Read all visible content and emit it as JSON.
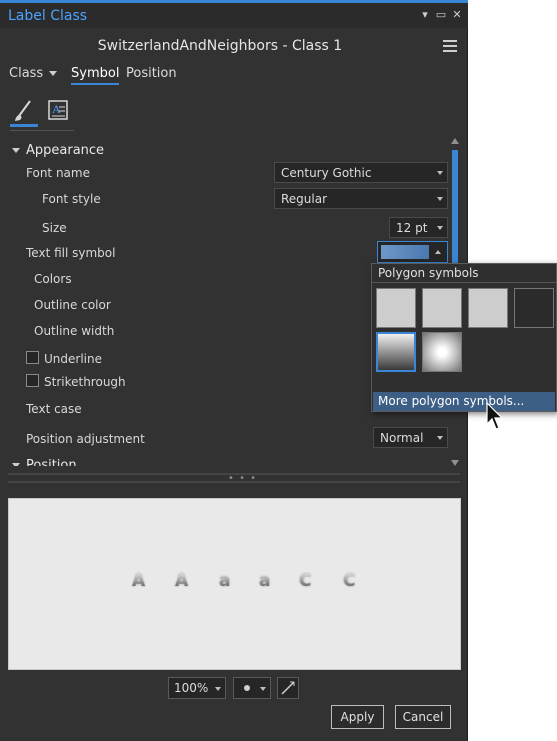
{
  "window": {
    "title": "Label Class",
    "layer_name": "SwitzerlandAndNeighbors - Class 1"
  },
  "tabs": [
    {
      "label": "Class"
    },
    {
      "label": "Symbol"
    },
    {
      "label": "Position"
    }
  ],
  "appearance": {
    "section_label": "Appearance",
    "font_name_label": "Font name",
    "font_name_value": "Century Gothic",
    "font_style_label": "Font style",
    "font_style_value": "Regular",
    "size_label": "Size",
    "size_value": "12 pt",
    "text_fill_label": "Text fill symbol",
    "colors_label": "Colors",
    "outline_color_label": "Outline color",
    "outline_width_label": "Outline width",
    "underline_label": "Underline",
    "strikethrough_label": "Strikethrough",
    "text_case_label": "Text case",
    "position_adjustment_label": "Position adjustment",
    "position_adjustment_value": "Normal",
    "next_section_label": "Position"
  },
  "popup": {
    "title": "Polygon symbols",
    "more_label": "More polygon symbols..."
  },
  "preview": {
    "glyphs": [
      "A",
      "A",
      "a",
      "a",
      "C",
      "C"
    ]
  },
  "bottom": {
    "zoom_value": "100%",
    "apply_label": "Apply",
    "cancel_label": "Cancel"
  },
  "colors": {
    "accent": "#3a86d6",
    "panel_bg": "#323232",
    "highlight": "#3d5f86"
  }
}
